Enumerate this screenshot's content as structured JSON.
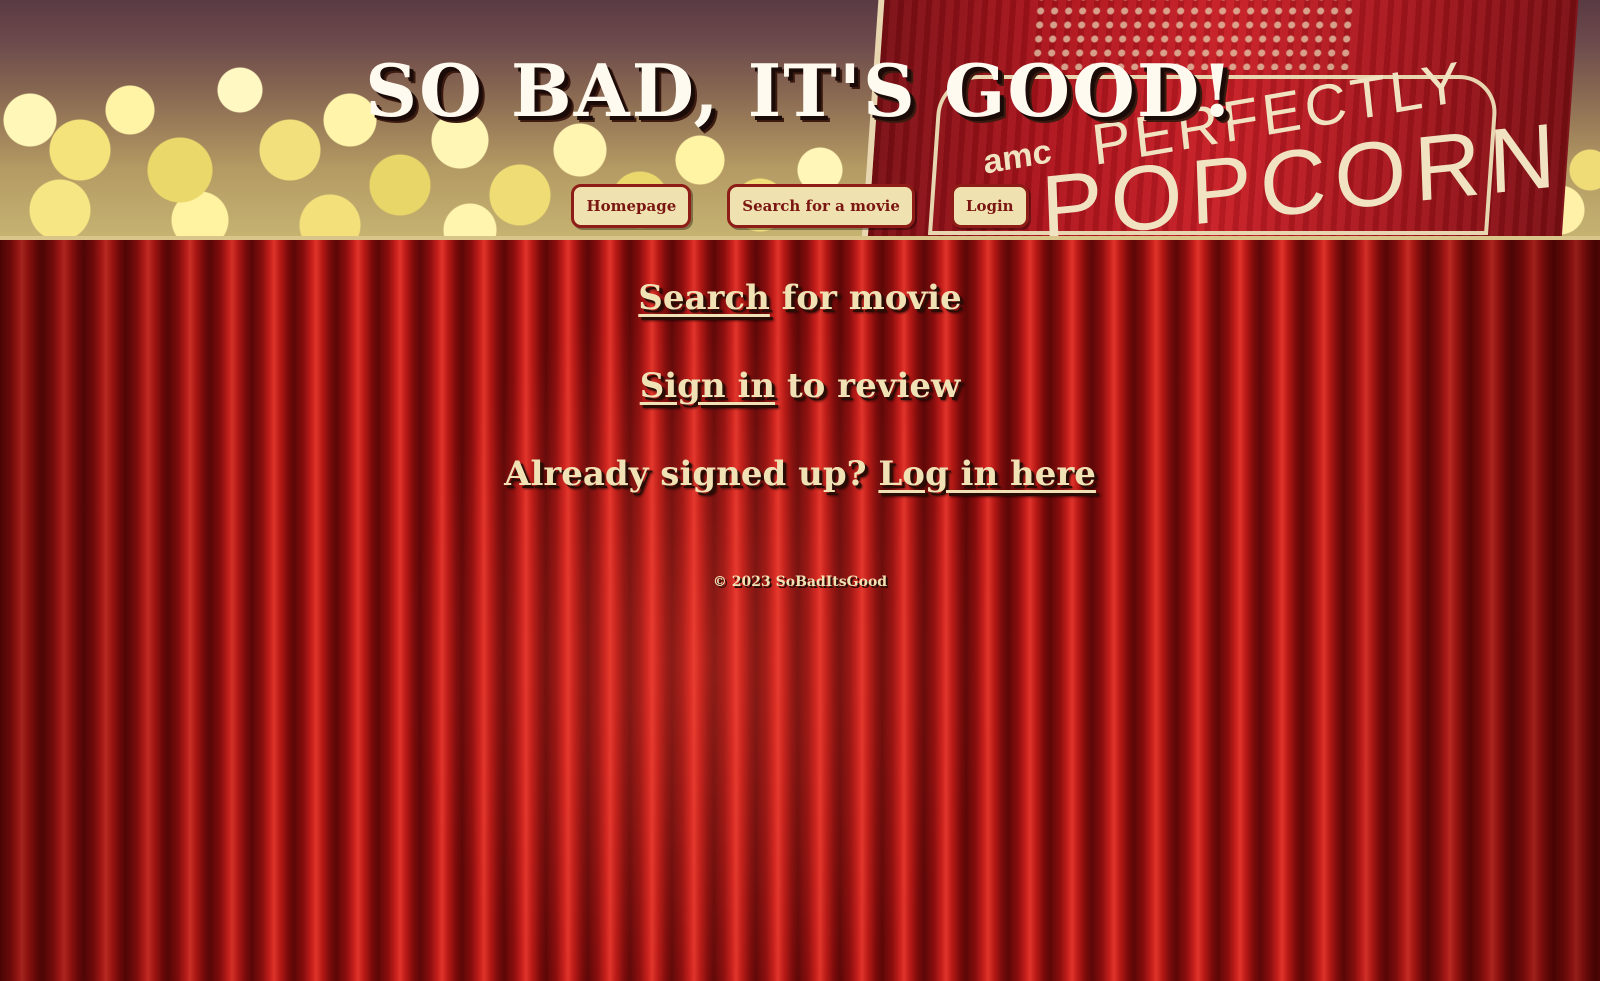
{
  "header": {
    "title": "SO BAD, IT'S GOOD!",
    "bucket_text": {
      "amc": "amc",
      "line1": "PERFECTLY",
      "line2": "POPCORN"
    }
  },
  "nav": {
    "items": [
      {
        "label": "Homepage"
      },
      {
        "label": "Search for a movie"
      },
      {
        "label": "Login"
      }
    ]
  },
  "main": {
    "search_link": "Search",
    "search_rest": " for movie",
    "signin_link": "Sign in",
    "signin_rest": " to review",
    "login_prefix": "Already signed up? ",
    "login_link": "Log in here"
  },
  "footer": {
    "copyright": "© 2023 SoBadItsGood"
  },
  "colors": {
    "curtain": "#b81a16",
    "button_bg": "#efe1b0",
    "button_border": "#8e1c17",
    "text_cream": "#f1e2b6"
  }
}
